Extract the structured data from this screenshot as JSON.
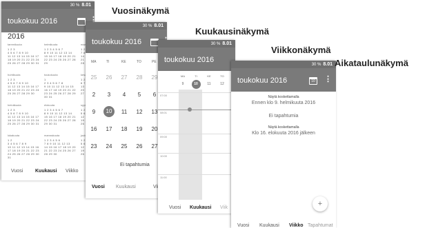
{
  "labels": {
    "year": "Vuosinäkymä",
    "month": "Kuukausinäkymä",
    "week": "Viikkonäkymä",
    "schedule": "Aikataulunäkymä"
  },
  "status": {
    "battery": "30 %",
    "time": "8.01"
  },
  "app_title": "toukokuu 2016",
  "cal_icon_day": "10",
  "tabs": {
    "year": "Vuosi",
    "month": "Kuukausi",
    "week": "Viikko",
    "schedule": "Tapahtumat",
    "schedule_cut": "T",
    "week_cut": "Viik"
  },
  "year_view": {
    "year": "2016",
    "months": [
      {
        "name": "tammikuuta",
        "rows": [
          "        1 2 3",
          "4 5 6 7 8 9 10",
          "11 12 13 14 15 16 17",
          "18 19 20 21 22 23 24",
          "25 26 27 28 29 30 31"
        ]
      },
      {
        "name": "helmikuuta",
        "rows": [
          "1 2 3 4 5 6 7",
          "8 9 10 11 12 13 14",
          "15 16 17 18 19 20 21",
          "22 23 24 25 26 27 28",
          "29"
        ]
      },
      {
        "name": "maal",
        "rows": [
          "  1 2 3",
          "7 8 9 10",
          "14 15 16",
          "21 22 23",
          "28 29 30"
        ]
      },
      {
        "name": "huhtikuuta",
        "rows": [
          "      1 2 3",
          "4 5 6 7 8 9 10",
          "11 12 13 14 15 16 17",
          "18 19 20 21 22 23 24",
          "25 26 27 28 29 30"
        ]
      },
      {
        "name": "toukokuuta",
        "rows": [
          "            1",
          "2 3 4 5 6 7 8",
          "9 10 11 12 13 14 15",
          "16 17 18 19 20 21 22",
          "23 24 25 26 27 28 29",
          "30 31"
        ]
      },
      {
        "name": "kesä",
        "rows": [
          "  1 2",
          "6 7 8 9",
          "13 14 15",
          "20 21 22",
          "27 28 29"
        ]
      },
      {
        "name": "heinäkuuta",
        "rows": [
          "      1 2 3",
          "4 5 6 7 8 9 10",
          "11 12 13 14 15 16 17",
          "18 19 20 21 22 23 24",
          "25 26 27 28 29 30 31"
        ]
      },
      {
        "name": "elokuuta",
        "rows": [
          "1 2 3 4 5 6 7",
          "8 9 10 11 12 13 14",
          "15 16 17 18 19 20 21",
          "22 23 24 25 26 27 28",
          "29 30 31"
        ]
      },
      {
        "name": "syys",
        "rows": [
          "  1 2",
          "5 6 7 8",
          "12 13 14",
          "19 20 21",
          "26 27 28"
        ]
      },
      {
        "name": "lokakuuta",
        "rows": [
          "        1 2",
          "3 4 5 6 7 8 9",
          "10 11 12 13 14 15 16",
          "17 18 19 20 21 22 23",
          "24 25 26 27 28 29 30",
          "31"
        ]
      },
      {
        "name": "marraskuuta",
        "rows": [
          "  1 2 3 4 5 6",
          "7 8 9 10 11 12 13",
          "14 15 16 17 18 19 20",
          "21 22 23 24 25 26 27",
          "28 29 30"
        ]
      },
      {
        "name": "joulu",
        "rows": [
          "  1 2",
          "5 6 7 8",
          "12 13 14",
          "19 20 21",
          "26 27 28"
        ]
      }
    ]
  },
  "month_view": {
    "headers": [
      "MA",
      "TI",
      "KE",
      "TO",
      "PE"
    ],
    "weeks": [
      [
        "25",
        "26",
        "27",
        "28",
        "29"
      ],
      [
        "2",
        "3",
        "4",
        "5",
        "6"
      ],
      [
        "9",
        "10",
        "11",
        "12",
        "13"
      ],
      [
        "16",
        "17",
        "18",
        "19",
        "20"
      ],
      [
        "23",
        "24",
        "25",
        "26",
        "27"
      ]
    ],
    "selected": "10",
    "no_events": "Ei tapahtumia"
  },
  "week_view": {
    "headers": [
      "MA",
      "TI",
      "KE",
      "TO"
    ],
    "dates": [
      "9",
      "10",
      "11",
      "12"
    ],
    "selected": "10",
    "times": [
      "07:00",
      "08:01",
      "09:00",
      "10:00",
      "11:00"
    ]
  },
  "schedule_view": {
    "hint1": "Näytä koskettamalla",
    "before": "Ennen klo 9. helmikuuta 2016",
    "no_events": "Ei tapahtumia",
    "hint2": "Näytä koskettamalla",
    "after": "Klo 16. elokuuta 2016 jälkeen",
    "fab": "+"
  }
}
